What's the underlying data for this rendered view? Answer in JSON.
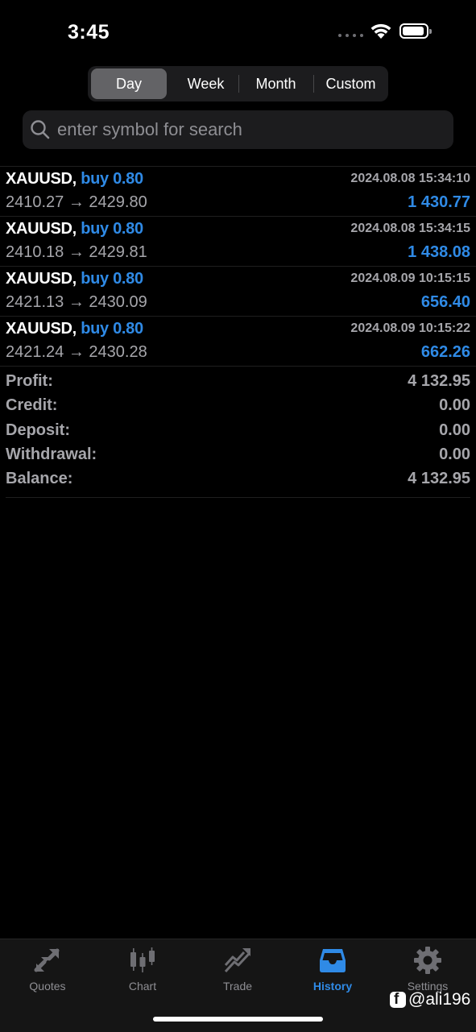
{
  "status": {
    "time": "3:45"
  },
  "segments": [
    {
      "label": "Day",
      "active": true
    },
    {
      "label": "Week",
      "active": false
    },
    {
      "label": "Month",
      "active": false
    },
    {
      "label": "Custom",
      "active": false
    }
  ],
  "search": {
    "placeholder": "enter symbol for search"
  },
  "deals": [
    {
      "symbol": "XAUUSD,",
      "direction": "buy 0.80",
      "prices": "2410.27 → 2429.80",
      "date": "2024.08.08 15:34:10",
      "profit": "1 430.77"
    },
    {
      "symbol": "XAUUSD,",
      "direction": "buy 0.80",
      "prices": "2410.18 → 2429.81",
      "date": "2024.08.08 15:34:15",
      "profit": "1 438.08"
    },
    {
      "symbol": "XAUUSD,",
      "direction": "buy 0.80",
      "prices": "2421.13 → 2430.09",
      "date": "2024.08.09 10:15:15",
      "profit": "656.40"
    },
    {
      "symbol": "XAUUSD,",
      "direction": "buy 0.80",
      "prices": "2421.24 → 2430.28",
      "date": "2024.08.09 10:15:22",
      "profit": "662.26"
    }
  ],
  "summary": [
    {
      "label": "Profit:",
      "value": "4 132.95"
    },
    {
      "label": "Credit:",
      "value": "0.00"
    },
    {
      "label": "Deposit:",
      "value": "0.00"
    },
    {
      "label": "Withdrawal:",
      "value": "0.00"
    },
    {
      "label": "Balance:",
      "value": "4 132.95"
    }
  ],
  "tabs": [
    {
      "label": "Quotes",
      "icon": "quotes-icon",
      "active": false
    },
    {
      "label": "Chart",
      "icon": "chart-icon",
      "active": false
    },
    {
      "label": "Trade",
      "icon": "trade-icon",
      "active": false
    },
    {
      "label": "History",
      "icon": "history-icon",
      "active": true
    },
    {
      "label": "Settings",
      "icon": "gear-icon",
      "active": false
    }
  ],
  "watermark": {
    "text": "@ali196",
    "icon": "facebook-icon"
  },
  "colors": {
    "accent": "#2f8ae6",
    "background": "#000000",
    "muted": "#a6a6ab"
  }
}
